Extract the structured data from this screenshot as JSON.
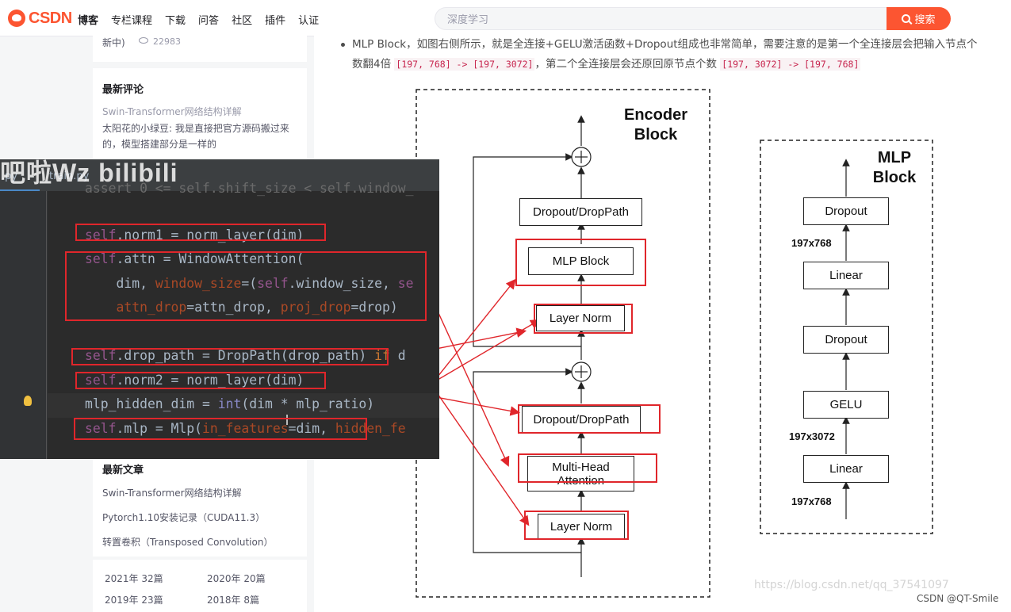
{
  "header": {
    "logo": "CSDN",
    "nav": [
      "博客",
      "专栏课程",
      "下载",
      "问答",
      "社区",
      "插件",
      "认证"
    ],
    "search_placeholder": "深度学习",
    "search_button": "搜索"
  },
  "sidebar": {
    "top_card": {
      "text": "新中)",
      "views": "22983"
    },
    "comments": {
      "title": "最新评论",
      "link": "Swin-Transformer网络结构详解",
      "text": "太阳花的小绿豆: 我是直接把官方源码搬过来的，模型搭建部分是一样的"
    },
    "articles": {
      "title": "最新文章",
      "items": [
        "Swin-Transformer网络结构详解",
        "Pytorch1.10安装记录（CUDA11.3）",
        "转置卷积（Transposed Convolution）"
      ]
    },
    "archive": [
      "2021年  32篇",
      "2020年  20篇",
      "2019年  23篇",
      "2018年  8篇"
    ]
  },
  "article": {
    "para_prefix": "MLP Block，如图右侧所示，就是全连接+GELU激活函数+Dropout组成也非常简单，需要注意的是第一个全连接层会把输入节点个",
    "para_line2_prefix": "数翻4倍",
    "code1": "[197, 768] -> [197, 3072]",
    "para_mid": "，第二个全连接层会还原回原节点个数",
    "code2": "[197, 3072] -> [197, 768]",
    "watermark": "https://blog.csdn.net/qq_37541097",
    "credit": "CSDN @QT-Smile"
  },
  "diagram": {
    "encoder_title": "Encoder\nBlock",
    "mlp_title": "MLP\nBlock",
    "encoder_blocks": [
      "Dropout/DropPath",
      "MLP Block",
      "Layer Norm",
      "Dropout/DropPath",
      "Multi-Head\nAttention",
      "Layer Norm"
    ],
    "mlp_blocks": [
      "Dropout",
      "Linear",
      "Dropout",
      "GELU",
      "Linear"
    ],
    "mlp_dims": [
      "197x768",
      "197x3072",
      "197x768"
    ],
    "plus": "+"
  },
  "ide": {
    "watermark": "吧啦Wz bilibili",
    "tabs": [
      ".py",
      "train.py"
    ],
    "code_lines": [
      "assert 0 <= self.shift_size < self.window_",
      "",
      "self.norm1 = norm_layer(dim)",
      "self.attn = WindowAttention(",
      "    dim, window_size=(self.window_size, se",
      "    attn_drop=attn_drop, proj_drop=drop)",
      "",
      "self.drop_path = DropPath(drop_path) if d",
      "self.norm2 = norm_layer(dim)",
      "mlp_hidden_dim = int(dim * mlp_ratio)",
      "self.mlp = Mlp(in_features=dim, hidden_fe"
    ]
  },
  "colors": {
    "brand": "#fc5531",
    "annotation_red": "#e0262b",
    "ide_bg": "#2b2b2b"
  }
}
